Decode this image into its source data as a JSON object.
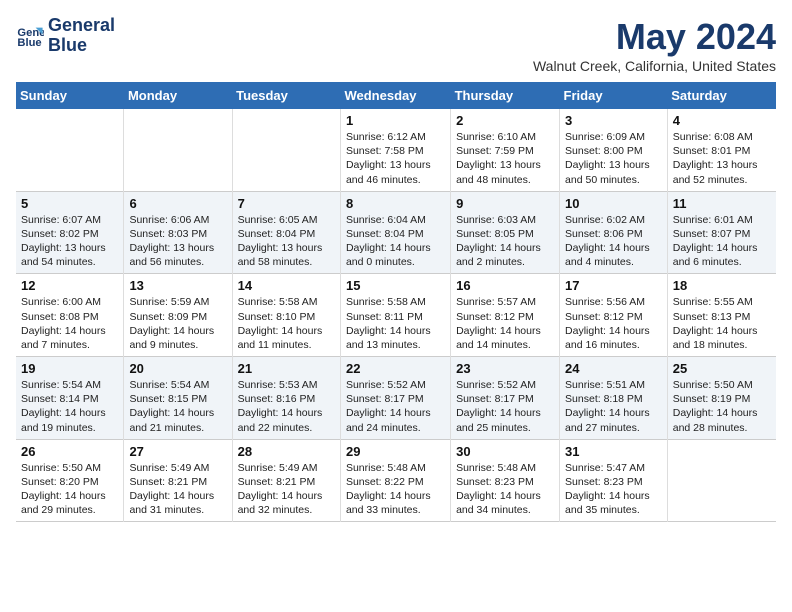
{
  "logo": {
    "line1": "General",
    "line2": "Blue"
  },
  "title": "May 2024",
  "location": "Walnut Creek, California, United States",
  "headers": [
    "Sunday",
    "Monday",
    "Tuesday",
    "Wednesday",
    "Thursday",
    "Friday",
    "Saturday"
  ],
  "weeks": [
    [
      {
        "day": "",
        "text": ""
      },
      {
        "day": "",
        "text": ""
      },
      {
        "day": "",
        "text": ""
      },
      {
        "day": "1",
        "text": "Sunrise: 6:12 AM\nSunset: 7:58 PM\nDaylight: 13 hours\nand 46 minutes."
      },
      {
        "day": "2",
        "text": "Sunrise: 6:10 AM\nSunset: 7:59 PM\nDaylight: 13 hours\nand 48 minutes."
      },
      {
        "day": "3",
        "text": "Sunrise: 6:09 AM\nSunset: 8:00 PM\nDaylight: 13 hours\nand 50 minutes."
      },
      {
        "day": "4",
        "text": "Sunrise: 6:08 AM\nSunset: 8:01 PM\nDaylight: 13 hours\nand 52 minutes."
      }
    ],
    [
      {
        "day": "5",
        "text": "Sunrise: 6:07 AM\nSunset: 8:02 PM\nDaylight: 13 hours\nand 54 minutes."
      },
      {
        "day": "6",
        "text": "Sunrise: 6:06 AM\nSunset: 8:03 PM\nDaylight: 13 hours\nand 56 minutes."
      },
      {
        "day": "7",
        "text": "Sunrise: 6:05 AM\nSunset: 8:04 PM\nDaylight: 13 hours\nand 58 minutes."
      },
      {
        "day": "8",
        "text": "Sunrise: 6:04 AM\nSunset: 8:04 PM\nDaylight: 14 hours\nand 0 minutes."
      },
      {
        "day": "9",
        "text": "Sunrise: 6:03 AM\nSunset: 8:05 PM\nDaylight: 14 hours\nand 2 minutes."
      },
      {
        "day": "10",
        "text": "Sunrise: 6:02 AM\nSunset: 8:06 PM\nDaylight: 14 hours\nand 4 minutes."
      },
      {
        "day": "11",
        "text": "Sunrise: 6:01 AM\nSunset: 8:07 PM\nDaylight: 14 hours\nand 6 minutes."
      }
    ],
    [
      {
        "day": "12",
        "text": "Sunrise: 6:00 AM\nSunset: 8:08 PM\nDaylight: 14 hours\nand 7 minutes."
      },
      {
        "day": "13",
        "text": "Sunrise: 5:59 AM\nSunset: 8:09 PM\nDaylight: 14 hours\nand 9 minutes."
      },
      {
        "day": "14",
        "text": "Sunrise: 5:58 AM\nSunset: 8:10 PM\nDaylight: 14 hours\nand 11 minutes."
      },
      {
        "day": "15",
        "text": "Sunrise: 5:58 AM\nSunset: 8:11 PM\nDaylight: 14 hours\nand 13 minutes."
      },
      {
        "day": "16",
        "text": "Sunrise: 5:57 AM\nSunset: 8:12 PM\nDaylight: 14 hours\nand 14 minutes."
      },
      {
        "day": "17",
        "text": "Sunrise: 5:56 AM\nSunset: 8:12 PM\nDaylight: 14 hours\nand 16 minutes."
      },
      {
        "day": "18",
        "text": "Sunrise: 5:55 AM\nSunset: 8:13 PM\nDaylight: 14 hours\nand 18 minutes."
      }
    ],
    [
      {
        "day": "19",
        "text": "Sunrise: 5:54 AM\nSunset: 8:14 PM\nDaylight: 14 hours\nand 19 minutes."
      },
      {
        "day": "20",
        "text": "Sunrise: 5:54 AM\nSunset: 8:15 PM\nDaylight: 14 hours\nand 21 minutes."
      },
      {
        "day": "21",
        "text": "Sunrise: 5:53 AM\nSunset: 8:16 PM\nDaylight: 14 hours\nand 22 minutes."
      },
      {
        "day": "22",
        "text": "Sunrise: 5:52 AM\nSunset: 8:17 PM\nDaylight: 14 hours\nand 24 minutes."
      },
      {
        "day": "23",
        "text": "Sunrise: 5:52 AM\nSunset: 8:17 PM\nDaylight: 14 hours\nand 25 minutes."
      },
      {
        "day": "24",
        "text": "Sunrise: 5:51 AM\nSunset: 8:18 PM\nDaylight: 14 hours\nand 27 minutes."
      },
      {
        "day": "25",
        "text": "Sunrise: 5:50 AM\nSunset: 8:19 PM\nDaylight: 14 hours\nand 28 minutes."
      }
    ],
    [
      {
        "day": "26",
        "text": "Sunrise: 5:50 AM\nSunset: 8:20 PM\nDaylight: 14 hours\nand 29 minutes."
      },
      {
        "day": "27",
        "text": "Sunrise: 5:49 AM\nSunset: 8:21 PM\nDaylight: 14 hours\nand 31 minutes."
      },
      {
        "day": "28",
        "text": "Sunrise: 5:49 AM\nSunset: 8:21 PM\nDaylight: 14 hours\nand 32 minutes."
      },
      {
        "day": "29",
        "text": "Sunrise: 5:48 AM\nSunset: 8:22 PM\nDaylight: 14 hours\nand 33 minutes."
      },
      {
        "day": "30",
        "text": "Sunrise: 5:48 AM\nSunset: 8:23 PM\nDaylight: 14 hours\nand 34 minutes."
      },
      {
        "day": "31",
        "text": "Sunrise: 5:47 AM\nSunset: 8:23 PM\nDaylight: 14 hours\nand 35 minutes."
      },
      {
        "day": "",
        "text": ""
      }
    ]
  ]
}
